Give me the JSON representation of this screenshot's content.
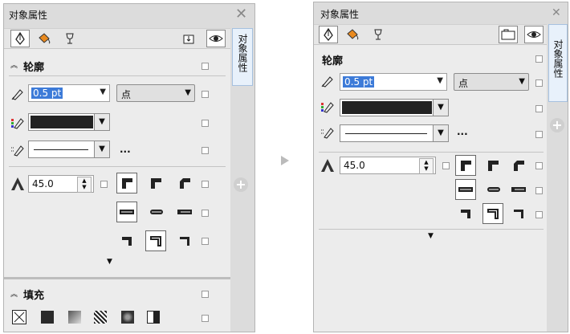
{
  "arrow_icon": "right-arrow-icon",
  "left": {
    "title": "对象属性",
    "side_tab": "对象属性",
    "outline_label": "轮廓",
    "width_value": "0.5 pt",
    "unit_value": "点",
    "more_label": "...",
    "miter_value": "45.0",
    "fill_label": "填充"
  },
  "right": {
    "title": "对象属性",
    "side_tab": "对象属性",
    "outline_label": "轮廓",
    "width_value": "0.5 pt",
    "unit_value": "点",
    "more_label": "...",
    "miter_value": "45.0"
  },
  "colors": {
    "outline_color": "#222222",
    "selection_highlight": "#3d7bd8",
    "side_tab_bg": "#e8f1fb"
  }
}
